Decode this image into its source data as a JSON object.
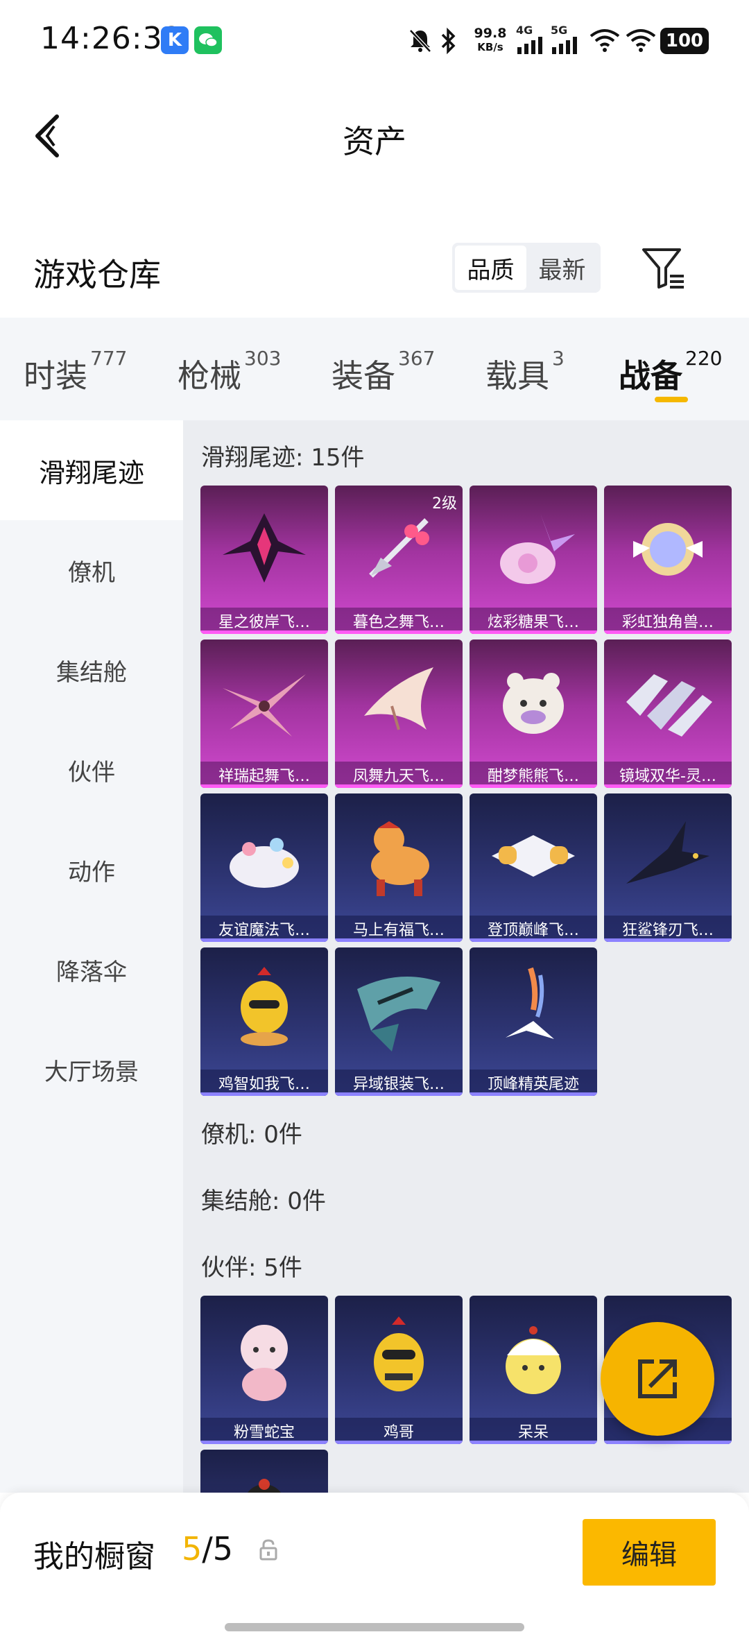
{
  "status_bar": {
    "time": "14:26:32",
    "net_speed": "99.8",
    "net_unit": "KB/s",
    "sim1": "4G",
    "sim2": "5G",
    "battery": "100",
    "app_icon_1": "k-icon",
    "app_icon_2": "wechat-icon"
  },
  "header": {
    "title": "资产"
  },
  "warehouse": {
    "title": "游戏仓库",
    "sort_options": [
      "品质",
      "最新"
    ],
    "sort_selected": "品质"
  },
  "tabs": [
    {
      "label": "时装",
      "count": "777"
    },
    {
      "label": "枪械",
      "count": "303"
    },
    {
      "label": "装备",
      "count": "367"
    },
    {
      "label": "载具",
      "count": "3"
    },
    {
      "label": "战备",
      "count": "220",
      "active": true
    }
  ],
  "sidebar": {
    "items": [
      "滑翔尾迹",
      "僚机",
      "集结舱",
      "伙伴",
      "动作",
      "降落伞",
      "大厅场景"
    ],
    "active": "滑翔尾迹"
  },
  "groups": {
    "glide_trail": {
      "title": "滑翔尾迹: 15件",
      "items": [
        {
          "name": "星之彼岸飞…",
          "quality": "purple",
          "badge": ""
        },
        {
          "name": "暮色之舞飞…",
          "quality": "purple",
          "badge": "2级"
        },
        {
          "name": "炫彩糖果飞…",
          "quality": "purple",
          "badge": ""
        },
        {
          "name": "彩虹独角兽…",
          "quality": "purple",
          "badge": ""
        },
        {
          "name": "祥瑞起舞飞…",
          "quality": "purple",
          "badge": ""
        },
        {
          "name": "凤舞九天飞…",
          "quality": "purple",
          "badge": ""
        },
        {
          "name": "酣梦熊熊飞…",
          "quality": "purple",
          "badge": ""
        },
        {
          "name": "镜域双华-灵…",
          "quality": "purple",
          "badge": ""
        },
        {
          "name": "友谊魔法飞…",
          "quality": "blue",
          "badge": ""
        },
        {
          "name": "马上有福飞…",
          "quality": "blue",
          "badge": ""
        },
        {
          "name": "登顶巅峰飞…",
          "quality": "blue",
          "badge": ""
        },
        {
          "name": "狂鲨锋刃飞…",
          "quality": "blue",
          "badge": ""
        },
        {
          "name": "鸡智如我飞…",
          "quality": "blue",
          "badge": ""
        },
        {
          "name": "异域银装飞…",
          "quality": "blue",
          "badge": ""
        },
        {
          "name": "顶峰精英尾迹",
          "quality": "blue",
          "badge": ""
        }
      ]
    },
    "wingman": {
      "title": "僚机: 0件"
    },
    "assembly_pod": {
      "title": "集结舱: 0件"
    },
    "partner": {
      "title": "伙伴: 5件",
      "items": [
        {
          "name": "粉雪蛇宝",
          "quality": "blue"
        },
        {
          "name": "鸡哥",
          "quality": "blue"
        },
        {
          "name": "呆呆",
          "quality": "blue"
        },
        {
          "name": "",
          "quality": "blue"
        },
        {
          "name": "",
          "quality": "blue"
        }
      ]
    }
  },
  "showcase": {
    "label": "我的橱窗",
    "current": "5",
    "separator": "/",
    "total": "5",
    "edit_label": "编辑"
  },
  "colors": {
    "accent": "#f6b400",
    "purple_card": "#a234a0",
    "blue_card": "#2d3472",
    "background": "#ebedf1"
  }
}
